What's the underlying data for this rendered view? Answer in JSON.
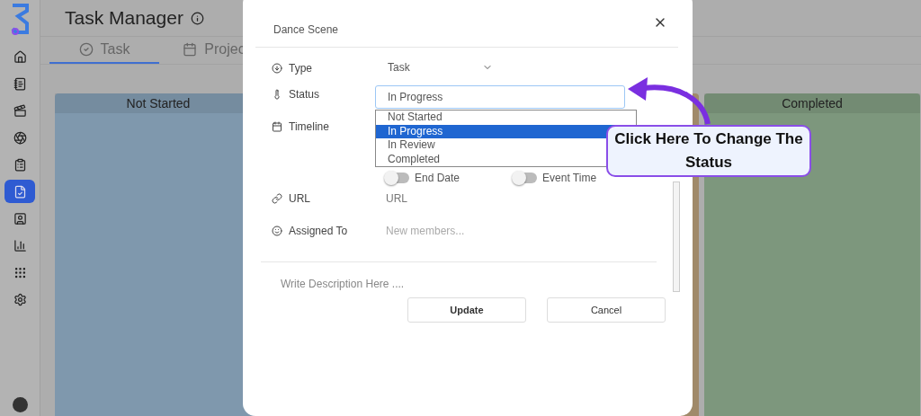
{
  "sidebar": {
    "items": [
      {
        "selected": false
      },
      {
        "selected": false
      },
      {
        "selected": false
      },
      {
        "selected": false
      },
      {
        "selected": false
      },
      {
        "selected": true
      },
      {
        "selected": false
      },
      {
        "selected": false
      },
      {
        "selected": false
      },
      {
        "selected": false
      }
    ]
  },
  "header": {
    "title": "Task Manager"
  },
  "tabs": [
    {
      "label": "Task",
      "selected": true
    },
    {
      "label": "Projec",
      "selected": false
    }
  ],
  "columns": [
    {
      "title": "Not Started",
      "color": "#7f98ad"
    },
    {
      "color": "#a08a6a"
    },
    {
      "title": "Completed",
      "color": "#7d977d"
    }
  ],
  "modal": {
    "title": "Dance Scene",
    "type": {
      "label": "Type",
      "value": "Task"
    },
    "status": {
      "label": "Status",
      "value": "In Progress",
      "options": [
        {
          "label": "Not Started",
          "selected": false
        },
        {
          "label": "In Progress",
          "selected": true
        },
        {
          "label": "In Review",
          "selected": false
        },
        {
          "label": "Completed",
          "selected": false
        }
      ]
    },
    "timeline": {
      "label": "Timeline",
      "toggles": [
        {
          "label": "End Date",
          "on": false
        },
        {
          "label": "Event Time",
          "on": false
        }
      ]
    },
    "url": {
      "label": "URL",
      "placeholder": "URL"
    },
    "assigned": {
      "label": "Assigned To",
      "placeholder": "New members..."
    },
    "description": {
      "placeholder": "Write Description Here ...."
    },
    "buttons": [
      "Update",
      "Cancel"
    ]
  },
  "callout": {
    "text": "Click Here To Change The Status"
  }
}
